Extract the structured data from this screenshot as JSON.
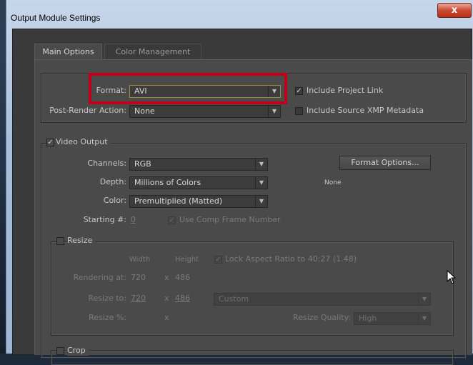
{
  "window": {
    "title": "Output Module Settings",
    "close_glyph": "x"
  },
  "tabs": [
    {
      "label": "Main Options",
      "selected": true
    },
    {
      "label": "Color Management",
      "selected": false
    }
  ],
  "format_section": {
    "format_label": "Format:",
    "format_value": "AVI",
    "post_render_label": "Post-Render Action:",
    "post_render_value": "None",
    "include_project_link": {
      "label": "Include Project Link",
      "checked": true
    },
    "include_xmp": {
      "label": "Include Source XMP Metadata",
      "checked": false
    }
  },
  "video_output": {
    "label": "Video Output",
    "checked": true,
    "channels_label": "Channels:",
    "channels_value": "RGB",
    "depth_label": "Depth:",
    "depth_value": "Millions of Colors",
    "color_label": "Color:",
    "color_value": "Premultiplied (Matted)",
    "starting_label": "Starting #:",
    "starting_value": "0",
    "use_comp_frame": {
      "label": "Use Comp Frame Number",
      "checked": true
    },
    "format_options_button": "Format Options...",
    "format_options_info": "None"
  },
  "resize": {
    "label": "Resize",
    "checked": false,
    "width_header": "Width",
    "height_header": "Height",
    "lock_aspect": {
      "label": "Lock Aspect Ratio to 40:27 (1.48)",
      "checked": true
    },
    "rendering_at_label": "Rendering at:",
    "rendering_width": "720",
    "rendering_height": "486",
    "times_sign": "x",
    "resize_to_label": "Resize to:",
    "resize_to_width": "720",
    "resize_to_height": "486",
    "resize_preset": "Custom",
    "resize_pct_label": "Resize %:",
    "resize_quality_label": "Resize Quality:",
    "resize_quality_value": "High"
  },
  "crop": {
    "label": "Crop",
    "checked": false
  },
  "colors": {
    "highlight": "#c0001a",
    "panel": "#4a4a4a",
    "titlebar": "#b7cbe4"
  }
}
